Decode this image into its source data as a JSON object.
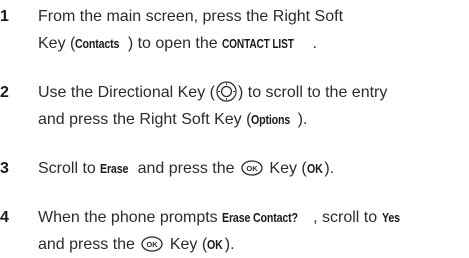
{
  "steps": [
    {
      "number": "1",
      "t1": "From the main screen, press the Right Soft",
      "t2": "Key (",
      "t3": "Contacts",
      "t4": ") to open the ",
      "t5": "CONTACT LIST",
      "t6": "."
    },
    {
      "number": "2",
      "t1": "Use the Directional Key (",
      "t2": ") to scroll to the entry",
      "t3": "and press the Right Soft Key (",
      "t4": "Options",
      "t5": ")."
    },
    {
      "number": "3",
      "t1": "Scroll to ",
      "t2": "Erase",
      "t3": " and press the ",
      "t4": " Key (",
      "t5": "OK",
      "t6": ")."
    },
    {
      "number": "4",
      "t1": "When the phone prompts ",
      "t2": "Erase Contact?",
      "t3": ", scroll to ",
      "t4": "Yes",
      "t5": "and press the ",
      "t6": " Key (",
      "t7": "OK",
      "t8": ")."
    }
  ],
  "icons": {
    "directional_key": "directional-key-icon",
    "ok_key": "ok-key-icon",
    "ok_key_label": "OK"
  }
}
